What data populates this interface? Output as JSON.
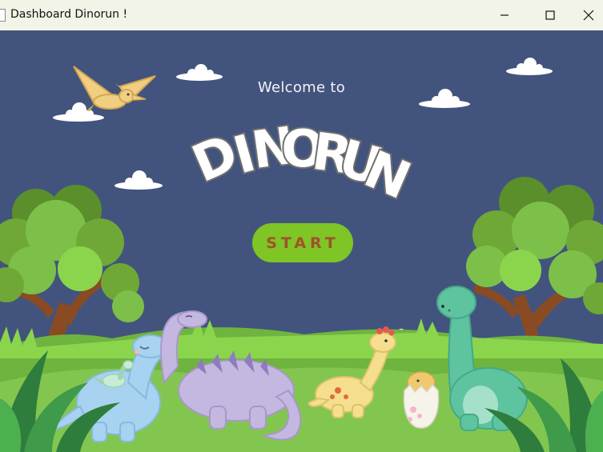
{
  "window": {
    "title": "Dashboard Dinorun !",
    "controls": [
      "minimize-icon",
      "maximize-icon",
      "close-icon"
    ]
  },
  "main": {
    "welcome_text": "Welcome to",
    "logo_text": "DINORUN",
    "start_label": "START"
  },
  "colors": {
    "sky": "#42547e",
    "start_button": "#7ec525",
    "start_text": "#a0512a",
    "grass": "#7cc04a"
  },
  "illustrations": [
    "pterodactyl",
    "clouds",
    "trees",
    "blue-dinosaur",
    "baby-dinosaur",
    "purple-dinosaur",
    "yellow-dinosaur",
    "hatching-egg",
    "green-dinosaur",
    "grass"
  ]
}
